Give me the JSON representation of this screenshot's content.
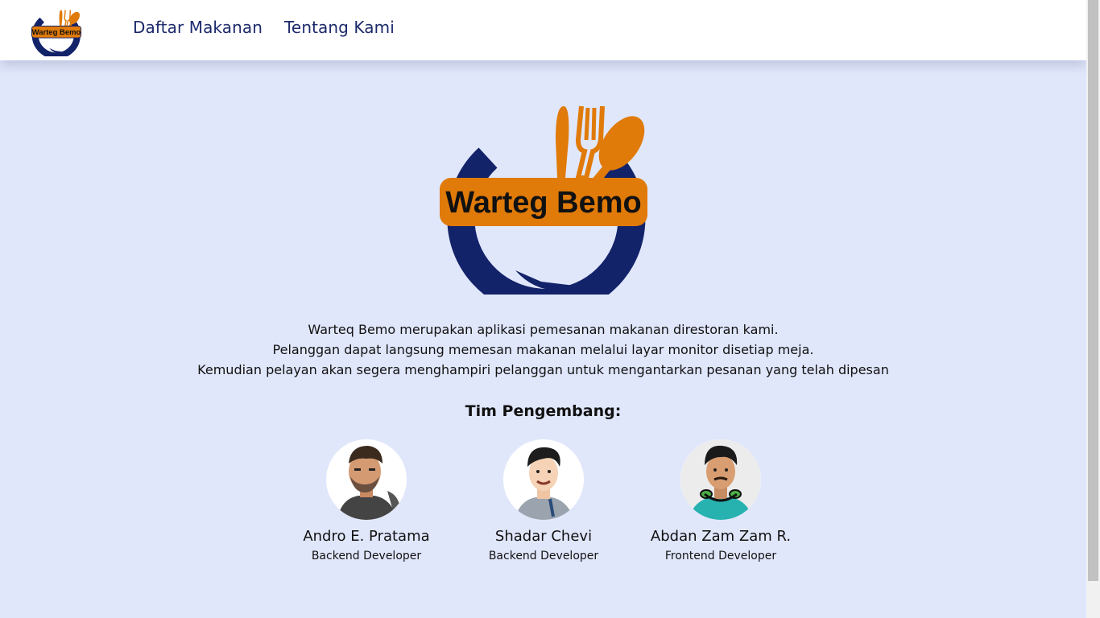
{
  "brand": {
    "name": "Warteg Bemo",
    "colors": {
      "navy": "#13236a",
      "orange": "#e07a09",
      "background": "#e1e7fb"
    }
  },
  "nav": {
    "links": [
      {
        "label": "Daftar Makanan"
      },
      {
        "label": "Tentang Kami"
      }
    ]
  },
  "about": {
    "lines": [
      "Warteq Bemo merupakan aplikasi pemesanan makanan direstoran kami.",
      "Pelanggan dapat langsung memesan makanan melalui layar monitor disetiap meja.",
      "Kemudian pelayan akan segera menghampiri pelanggan untuk mengantarkan pesanan yang telah dipesan"
    ],
    "team_heading": "Tim Pengembang:",
    "team": [
      {
        "name": "Andro E. Pratama",
        "role": "Backend Developer",
        "avatar_icon": "bearded-man-avatar"
      },
      {
        "name": "Shadar Chevi",
        "role": "Backend Developer",
        "avatar_icon": "smiling-man-avatar"
      },
      {
        "name": "Abdan Zam Zam R.",
        "role": "Frontend Developer",
        "avatar_icon": "headphones-man-avatar"
      }
    ]
  }
}
